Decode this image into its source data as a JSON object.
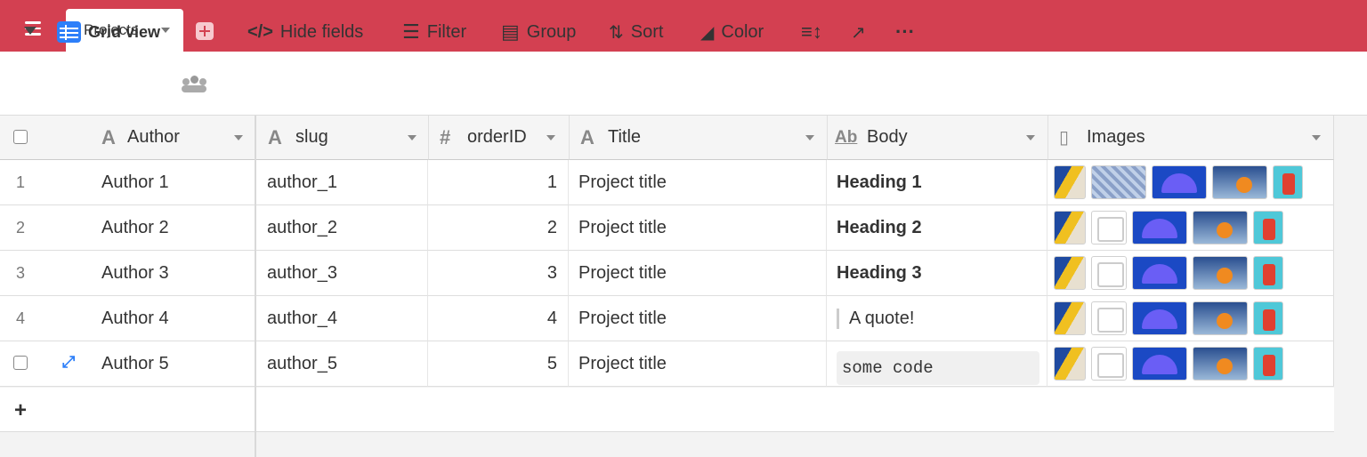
{
  "app": {
    "tab_label": "Projects",
    "colors": {
      "brand": "#d34051",
      "accent": "#2d7ff9"
    }
  },
  "toolbar": {
    "view_name": "Grid view",
    "hide_fields": "Hide fields",
    "filter": "Filter",
    "group": "Group",
    "sort": "Sort",
    "color": "Color"
  },
  "columns": [
    {
      "name": "Author",
      "type_icon": "A"
    },
    {
      "name": "slug",
      "type_icon": "A"
    },
    {
      "name": "orderID",
      "type_icon": "#"
    },
    {
      "name": "Title",
      "type_icon": "A"
    },
    {
      "name": "Body",
      "type_icon": "Ab"
    },
    {
      "name": "Images",
      "type_icon": "attachment-icon"
    }
  ],
  "rows": [
    {
      "num": "1",
      "author": "Author 1",
      "slug": "author_1",
      "orderID": "1",
      "title": "Project title",
      "body": "Heading 1",
      "body_style": "heading"
    },
    {
      "num": "2",
      "author": "Author 2",
      "slug": "author_2",
      "orderID": "2",
      "title": "Project title",
      "body": "Heading 2",
      "body_style": "heading"
    },
    {
      "num": "3",
      "author": "Author 3",
      "slug": "author_3",
      "orderID": "3",
      "title": "Project title",
      "body": "Heading 3",
      "body_style": "heading"
    },
    {
      "num": "4",
      "author": "Author 4",
      "slug": "author_4",
      "orderID": "4",
      "title": "Project title",
      "body": "A quote!",
      "body_style": "quote"
    },
    {
      "num": "",
      "author": "Author 5",
      "slug": "author_5",
      "orderID": "5",
      "title": "Project title",
      "body": "some code",
      "body_style": "code"
    }
  ]
}
